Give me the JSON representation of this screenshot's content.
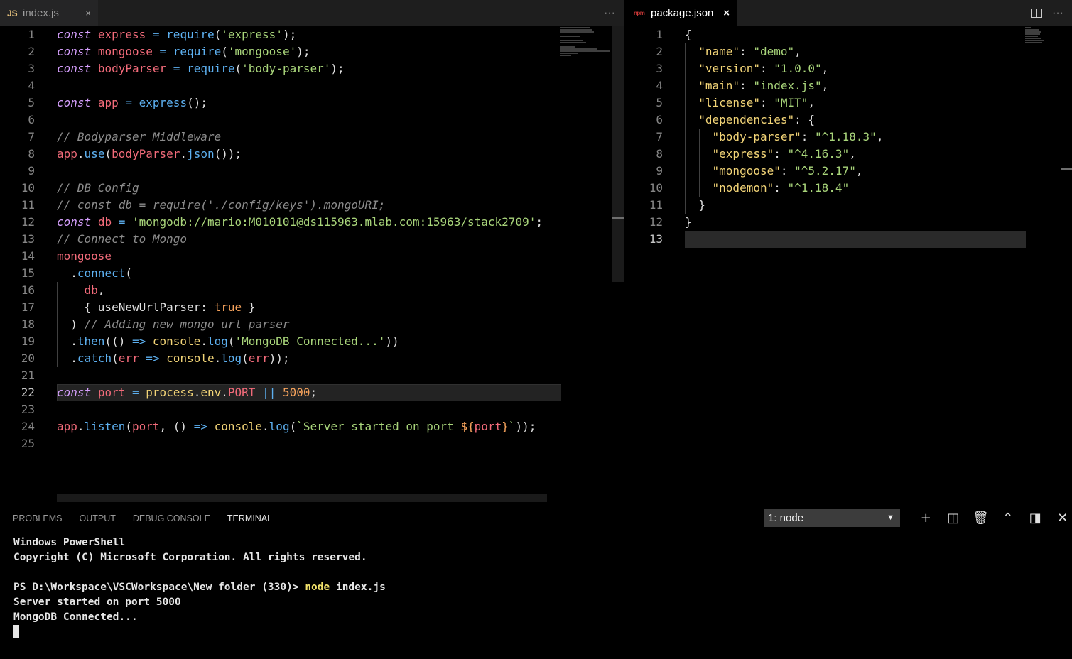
{
  "left_editor": {
    "tab": {
      "icon": "JS",
      "label": "index.js",
      "close": "×"
    },
    "actions_icon": "···",
    "active_line": 22,
    "lines": [
      [
        [
          "k",
          "const"
        ],
        [
          "p",
          " "
        ],
        [
          "v",
          "express"
        ],
        [
          "p",
          " "
        ],
        [
          "op",
          "="
        ],
        [
          "p",
          " "
        ],
        [
          "fn",
          "require"
        ],
        [
          "p",
          "("
        ],
        [
          "s",
          "'express'"
        ],
        [
          "p",
          ");"
        ]
      ],
      [
        [
          "k",
          "const"
        ],
        [
          "p",
          " "
        ],
        [
          "v",
          "mongoose"
        ],
        [
          "p",
          " "
        ],
        [
          "op",
          "="
        ],
        [
          "p",
          " "
        ],
        [
          "fn",
          "require"
        ],
        [
          "p",
          "("
        ],
        [
          "s",
          "'mongoose'"
        ],
        [
          "p",
          ");"
        ]
      ],
      [
        [
          "k",
          "const"
        ],
        [
          "p",
          " "
        ],
        [
          "v",
          "bodyParser"
        ],
        [
          "p",
          " "
        ],
        [
          "op",
          "="
        ],
        [
          "p",
          " "
        ],
        [
          "fn",
          "require"
        ],
        [
          "p",
          "("
        ],
        [
          "s",
          "'body-parser'"
        ],
        [
          "p",
          ");"
        ]
      ],
      [],
      [
        [
          "k",
          "const"
        ],
        [
          "p",
          " "
        ],
        [
          "v",
          "app"
        ],
        [
          "p",
          " "
        ],
        [
          "op",
          "="
        ],
        [
          "p",
          " "
        ],
        [
          "fn",
          "express"
        ],
        [
          "p",
          "();"
        ]
      ],
      [],
      [
        [
          "cm",
          "// Bodyparser Middleware"
        ]
      ],
      [
        [
          "v",
          "app"
        ],
        [
          "p",
          "."
        ],
        [
          "fn",
          "use"
        ],
        [
          "p",
          "("
        ],
        [
          "v",
          "bodyParser"
        ],
        [
          "p",
          "."
        ],
        [
          "fn",
          "json"
        ],
        [
          "p",
          "());"
        ]
      ],
      [],
      [
        [
          "cm",
          "// DB Config"
        ]
      ],
      [
        [
          "cm",
          "// const db = require('./config/keys').mongoURI;"
        ]
      ],
      [
        [
          "k",
          "const"
        ],
        [
          "p",
          " "
        ],
        [
          "v",
          "db"
        ],
        [
          "p",
          " "
        ],
        [
          "op",
          "="
        ],
        [
          "p",
          " "
        ],
        [
          "s",
          "'mongodb://mario:M010101@ds115963.mlab.com:15963/stack2709'"
        ],
        [
          "p",
          ";"
        ]
      ],
      [
        [
          "cm",
          "// Connect to Mongo"
        ]
      ],
      [
        [
          "v",
          "mongoose"
        ]
      ],
      [
        [
          "p",
          "  ."
        ],
        [
          "fn",
          "connect"
        ],
        [
          "p",
          "("
        ]
      ],
      [
        [
          "p",
          "    "
        ],
        [
          "v",
          "db"
        ],
        [
          "p",
          ","
        ]
      ],
      [
        [
          "p",
          "    { useNewUrlParser: "
        ],
        [
          "n",
          "true"
        ],
        [
          "p",
          " }"
        ]
      ],
      [
        [
          "p",
          "  ) "
        ],
        [
          "cm",
          "// Adding new mongo url parser"
        ]
      ],
      [
        [
          "p",
          "  ."
        ],
        [
          "fn",
          "then"
        ],
        [
          "p",
          "(() "
        ],
        [
          "op",
          "=>"
        ],
        [
          "p",
          " "
        ],
        [
          "fy",
          "console"
        ],
        [
          "p",
          "."
        ],
        [
          "fn",
          "log"
        ],
        [
          "p",
          "("
        ],
        [
          "s",
          "'MongoDB Connected...'"
        ],
        [
          "p",
          "))"
        ]
      ],
      [
        [
          "p",
          "  ."
        ],
        [
          "fn",
          "catch"
        ],
        [
          "p",
          "("
        ],
        [
          "v",
          "err"
        ],
        [
          "p",
          " "
        ],
        [
          "op",
          "=>"
        ],
        [
          "p",
          " "
        ],
        [
          "fy",
          "console"
        ],
        [
          "p",
          "."
        ],
        [
          "fn",
          "log"
        ],
        [
          "p",
          "("
        ],
        [
          "v",
          "err"
        ],
        [
          "p",
          "));"
        ]
      ],
      [],
      [
        [
          "k",
          "const"
        ],
        [
          "p",
          " "
        ],
        [
          "v",
          "port"
        ],
        [
          "p",
          " "
        ],
        [
          "op",
          "="
        ],
        [
          "p",
          " "
        ],
        [
          "fy",
          "process"
        ],
        [
          "p",
          "."
        ],
        [
          "fy",
          "env"
        ],
        [
          "p",
          "."
        ],
        [
          "v",
          "PORT"
        ],
        [
          "p",
          " "
        ],
        [
          "op",
          "||"
        ],
        [
          "p",
          " "
        ],
        [
          "n",
          "5000"
        ],
        [
          "p",
          ";"
        ]
      ],
      [],
      [
        [
          "v",
          "app"
        ],
        [
          "p",
          "."
        ],
        [
          "fn",
          "listen"
        ],
        [
          "p",
          "("
        ],
        [
          "v",
          "port"
        ],
        [
          "p",
          ", () "
        ],
        [
          "op",
          "=>"
        ],
        [
          "p",
          " "
        ],
        [
          "fy",
          "console"
        ],
        [
          "p",
          "."
        ],
        [
          "fn",
          "log"
        ],
        [
          "p",
          "("
        ],
        [
          "s",
          "`Server started on port "
        ],
        [
          "n",
          "${"
        ],
        [
          "v",
          "port"
        ],
        [
          "n",
          "}"
        ],
        [
          "s",
          "`"
        ],
        [
          "p",
          "));"
        ]
      ],
      []
    ]
  },
  "right_editor": {
    "tab": {
      "icon": "npm",
      "label": "package.json",
      "close": "×"
    },
    "split_icon": "split-editor-icon",
    "actions_icon": "···",
    "active_line": 13,
    "lines": [
      [
        [
          "p",
          "{"
        ]
      ],
      [
        [
          "p",
          "  "
        ],
        [
          "jk",
          "\"name\""
        ],
        [
          "p",
          ": "
        ],
        [
          "js",
          "\"demo\""
        ],
        [
          "p",
          ","
        ]
      ],
      [
        [
          "p",
          "  "
        ],
        [
          "jk",
          "\"version\""
        ],
        [
          "p",
          ": "
        ],
        [
          "js",
          "\"1.0.0\""
        ],
        [
          "p",
          ","
        ]
      ],
      [
        [
          "p",
          "  "
        ],
        [
          "jk",
          "\"main\""
        ],
        [
          "p",
          ": "
        ],
        [
          "js",
          "\"index.js\""
        ],
        [
          "p",
          ","
        ]
      ],
      [
        [
          "p",
          "  "
        ],
        [
          "jk",
          "\"license\""
        ],
        [
          "p",
          ": "
        ],
        [
          "js",
          "\"MIT\""
        ],
        [
          "p",
          ","
        ]
      ],
      [
        [
          "p",
          "  "
        ],
        [
          "jk",
          "\"dependencies\""
        ],
        [
          "p",
          ": {"
        ]
      ],
      [
        [
          "p",
          "    "
        ],
        [
          "jk",
          "\"body-parser\""
        ],
        [
          "p",
          ": "
        ],
        [
          "js",
          "\"^1.18.3\""
        ],
        [
          "p",
          ","
        ]
      ],
      [
        [
          "p",
          "    "
        ],
        [
          "jk",
          "\"express\""
        ],
        [
          "p",
          ": "
        ],
        [
          "js",
          "\"^4.16.3\""
        ],
        [
          "p",
          ","
        ]
      ],
      [
        [
          "p",
          "    "
        ],
        [
          "jk",
          "\"mongoose\""
        ],
        [
          "p",
          ": "
        ],
        [
          "js",
          "\"^5.2.17\""
        ],
        [
          "p",
          ","
        ]
      ],
      [
        [
          "p",
          "    "
        ],
        [
          "jk",
          "\"nodemon\""
        ],
        [
          "p",
          ": "
        ],
        [
          "js",
          "\"^1.18.4\""
        ]
      ],
      [
        [
          "p",
          "  }"
        ]
      ],
      [
        [
          "p",
          "}"
        ]
      ],
      []
    ]
  },
  "panel": {
    "tabs": [
      "PROBLEMS",
      "OUTPUT",
      "DEBUG CONSOLE",
      "TERMINAL"
    ],
    "active_tab": "TERMINAL",
    "terminal_select": "1: node",
    "terminal_select_arrow": "▼",
    "actions": [
      {
        "name": "new-terminal-icon",
        "glyph": "+"
      },
      {
        "name": "split-terminal-icon",
        "glyph": "◫"
      },
      {
        "name": "kill-terminal-icon",
        "glyph": "🗑"
      },
      {
        "name": "maximize-panel-icon",
        "glyph": "⌃"
      },
      {
        "name": "toggle-panel-position-icon",
        "glyph": "◨"
      },
      {
        "name": "close-panel-icon",
        "glyph": "✕"
      }
    ],
    "terminal": {
      "line1": "Windows PowerShell",
      "line2": "Copyright (C) Microsoft Corporation. All rights reserved.",
      "prompt": "PS D:\\Workspace\\VSCWorkspace\\New folder (330)> ",
      "command": "node",
      "args": " index.js",
      "out1": "Server started on port 5000",
      "out2": "MongoDB Connected..."
    }
  }
}
